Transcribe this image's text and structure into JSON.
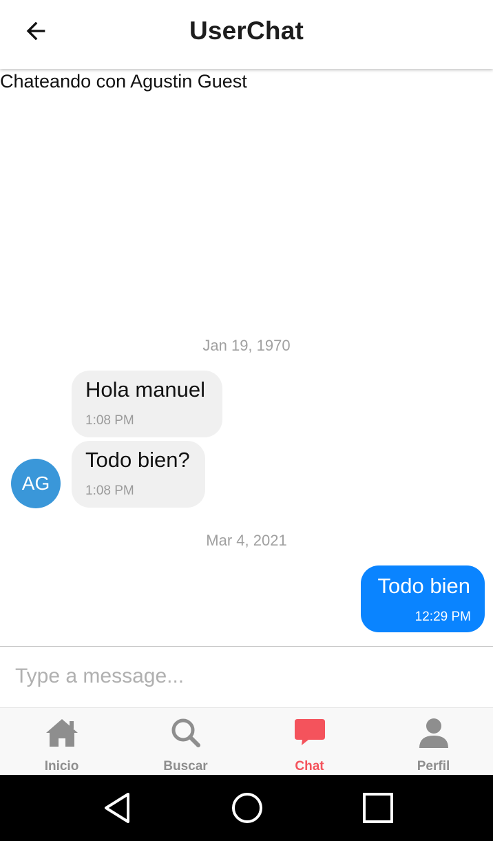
{
  "header": {
    "title": "UserChat"
  },
  "subtitle": "Chateando con Agustin Guest",
  "dates": [
    "Jan 19, 1970",
    "Mar 4, 2021"
  ],
  "messages_in": [
    {
      "text": "Hola manuel",
      "time": "1:08 PM"
    },
    {
      "text": "Todo bien?",
      "time": "1:08 PM"
    }
  ],
  "avatar": {
    "initials": "AG",
    "color": "#3a97d9"
  },
  "message_out": {
    "text": "Todo bien",
    "time": "12:29 PM",
    "color": "#0a84ff"
  },
  "composer": {
    "placeholder": "Type a message...",
    "value": ""
  },
  "tabs": [
    {
      "label": "Inicio",
      "icon": "home-icon"
    },
    {
      "label": "Buscar",
      "icon": "search-icon"
    },
    {
      "label": "Chat",
      "icon": "chat-icon",
      "active": true
    },
    {
      "label": "Perfil",
      "icon": "person-icon"
    }
  ],
  "colors": {
    "accent": "#f4535c",
    "tab_inactive": "#8e8e8e"
  },
  "system_nav": [
    "back-triangle-icon",
    "home-circle-icon",
    "recents-square-icon"
  ]
}
